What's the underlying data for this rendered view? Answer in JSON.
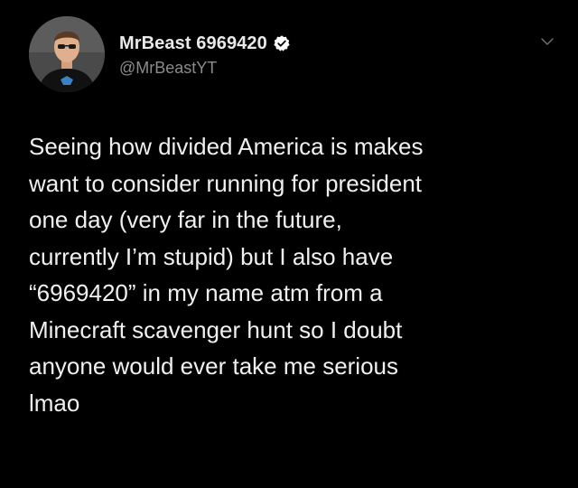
{
  "tweet": {
    "author": {
      "display_name": "MrBeast 6969420",
      "handle": "@MrBeastYT",
      "verified": true
    },
    "lines": [
      "Seeing how divided America is makes",
      "want to consider running for president",
      "one day (very far in the future,",
      "currently I’m stupid) but I also have",
      "“6969420” in my name atm from a",
      "Minecraft scavenger hunt so I doubt",
      "anyone would ever take me serious",
      "lmao"
    ]
  },
  "colors": {
    "background": "#000000",
    "text": "#e7e9ea",
    "handle": "#8b8b8b",
    "verified_badge": "#ffffff"
  },
  "icons": {
    "verified": "verified-badge-icon",
    "menu": "chevron-down-icon"
  }
}
